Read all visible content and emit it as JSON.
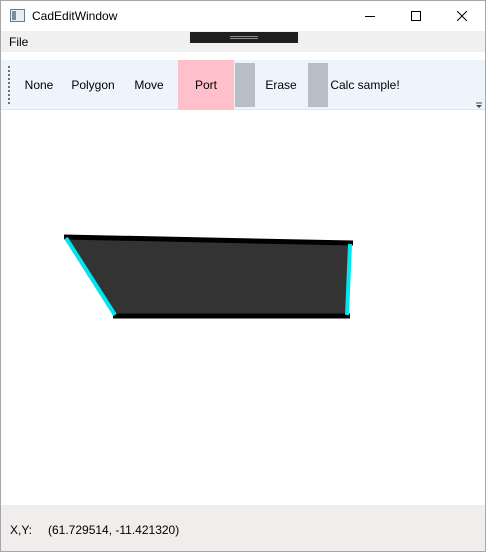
{
  "window": {
    "title": "CadEditWindow",
    "icon": "app-window-icon",
    "controls": [
      "minimize-icon",
      "maximize-icon",
      "close-icon"
    ]
  },
  "menu": {
    "file_label": "File"
  },
  "toolbar": {
    "none_label": "None",
    "polygon_label": "Polygon",
    "move_label": "Move",
    "port_label": "Port",
    "erase_label": "Erase",
    "calc_label": "Calc sample!",
    "active_tool": "Port",
    "active_color": "#ffc0cb",
    "separator_color": "#b8bec6"
  },
  "drawing": {
    "fill_color": "#333333",
    "edge_color": "#000000",
    "port_color": "#00e5ee"
  },
  "status": {
    "label": "X,Y:",
    "value": "(61.729514, -11.421320)"
  }
}
